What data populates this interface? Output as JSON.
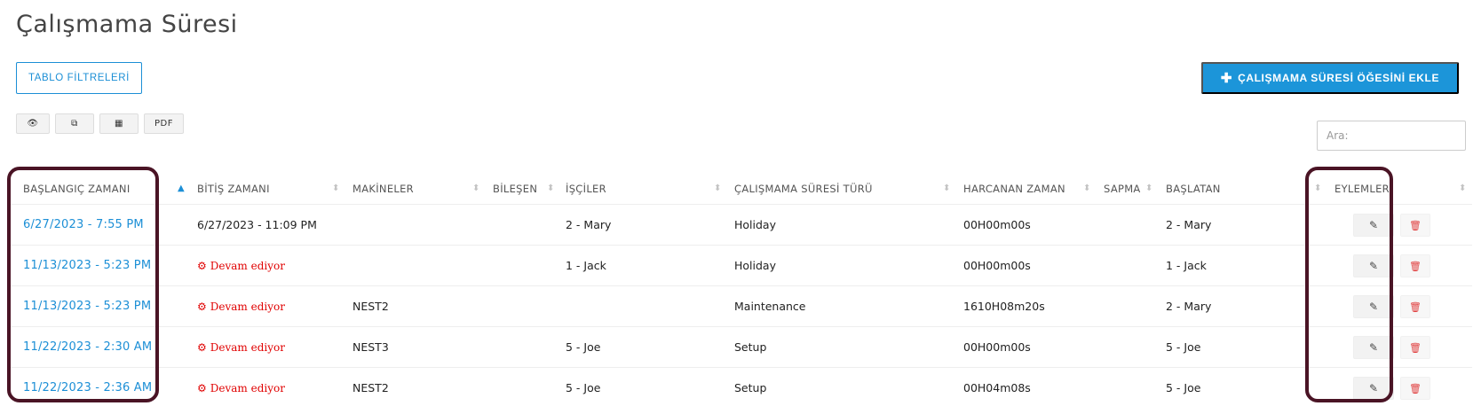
{
  "page": {
    "title": "Çalışmama Süresi"
  },
  "toolbar": {
    "filters_label": "TABLO FİLTRELERİ",
    "add_label": "ÇALIŞMAMA SÜRESİ ÖĞESİNİ EKLE",
    "add_icon": "plus-icon",
    "export": [
      {
        "icon": "eye-icon",
        "glyph": "👁"
      },
      {
        "icon": "copy-icon",
        "glyph": "⧉"
      },
      {
        "icon": "table-icon",
        "glyph": "▦"
      },
      {
        "label": "PDF"
      }
    ],
    "search_placeholder": "Ara:"
  },
  "table": {
    "columns": [
      "BAŞLANGIÇ ZAMANI",
      "BİTİŞ ZAMANI",
      "MAKİNELER",
      "BİLEŞEN",
      "İŞÇİLER",
      "ÇALIŞMAMA SÜRESİ TÜRÜ",
      "HARCANAN ZAMAN",
      "SAPMA",
      "BAŞLATAN",
      "EYLEMLER"
    ],
    "sort": {
      "asc": "▲",
      "both": "⬍"
    },
    "ongoing_label": "Devam ediyor",
    "rows": [
      {
        "start": "6/27/2023 - 7:55 PM",
        "end": "6/27/2023 - 11:09 PM",
        "machine": "",
        "component": "",
        "workers": "2 - Mary",
        "type": "Holiday",
        "elapsed": "00H00m00s",
        "deviation": "",
        "initiator": "2 - Mary"
      },
      {
        "start": "11/13/2023 - 5:23 PM",
        "end": "Devam ediyor",
        "machine": "",
        "component": "",
        "workers": "1 - Jack",
        "type": "Holiday",
        "elapsed": "00H00m00s",
        "deviation": "",
        "initiator": "1 - Jack"
      },
      {
        "start": "11/13/2023 - 5:23 PM",
        "end": "Devam ediyor",
        "machine": "NEST2",
        "component": "",
        "workers": "",
        "type": "Maintenance",
        "elapsed": "1610H08m20s",
        "deviation": "",
        "initiator": "2 - Mary"
      },
      {
        "start": "11/22/2023 - 2:30 AM",
        "end": "Devam ediyor",
        "machine": "NEST3",
        "component": "",
        "workers": "5 - Joe",
        "type": "Setup",
        "elapsed": "00H00m00s",
        "deviation": "",
        "initiator": "5 - Joe"
      },
      {
        "start": "11/22/2023 - 2:36 AM",
        "end": "Devam ediyor",
        "machine": "NEST2",
        "component": "",
        "workers": "5 - Joe",
        "type": "Setup",
        "elapsed": "00H04m08s",
        "deviation": "",
        "initiator": "5 - Joe"
      }
    ]
  },
  "colors": {
    "accent": "#1c95d9",
    "link": "#1c8fd6",
    "ongoing": "#e00000",
    "highlight": "#4a1425"
  }
}
